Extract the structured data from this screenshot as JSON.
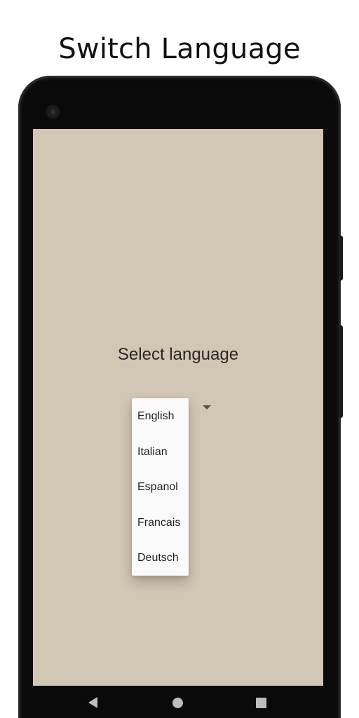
{
  "headline": "Switch Language",
  "screen": {
    "label": "Select language",
    "background_color": "#d2c6b5",
    "dropdown": {
      "expanded": true,
      "options": [
        "English",
        "Italian",
        "Espanol",
        "Francais",
        "Deutsch"
      ]
    }
  },
  "navigation": {
    "back_icon": "triangle-back-icon",
    "home_icon": "circle-home-icon",
    "recents_icon": "square-recents-icon"
  }
}
